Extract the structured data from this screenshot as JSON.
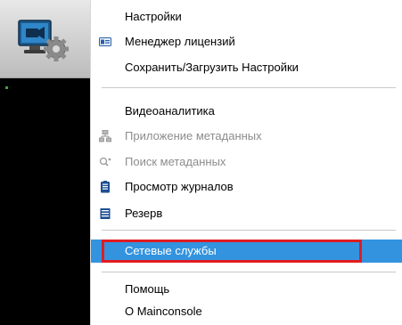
{
  "app_tile": {
    "icon": "video-camera-gear-icon"
  },
  "menu": {
    "items": [
      {
        "label": "Настройки",
        "icon": "",
        "disabled": false
      },
      {
        "label": "Менеджер лицензий",
        "icon": "license-card-icon",
        "disabled": false
      },
      {
        "label": "Сохранить/Загрузить Настройки",
        "icon": "",
        "disabled": false
      },
      {
        "label": "Видеоаналитика",
        "icon": "",
        "disabled": false
      },
      {
        "label": "Приложение метаданных",
        "icon": "network-nodes-icon",
        "disabled": true
      },
      {
        "label": "Поиск метаданных",
        "icon": "search-metadata-icon",
        "disabled": true
      },
      {
        "label": "Просмотр журналов",
        "icon": "clipboard-log-icon",
        "disabled": false
      },
      {
        "label": "Резерв",
        "icon": "backup-list-icon",
        "disabled": false
      },
      {
        "label": "Сетевые службы",
        "icon": "",
        "disabled": false,
        "selected": true
      },
      {
        "label": "Помощь",
        "icon": "",
        "disabled": false
      },
      {
        "label": "О Mainconsole",
        "icon": "",
        "disabled": false
      }
    ]
  },
  "colors": {
    "selection": "#3393df",
    "highlight_border": "#e11b22",
    "disabled_text": "#8c8c8c"
  }
}
